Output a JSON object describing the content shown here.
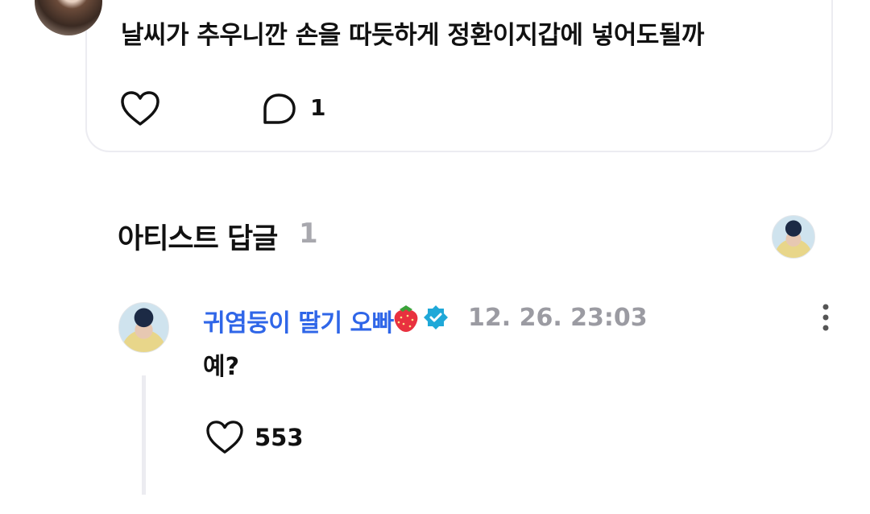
{
  "post": {
    "text": "날씨가 추우니깐 손을 따듯하게 정환이지갑에 넣어도될까",
    "comment_count": "1"
  },
  "artist_replies": {
    "title": "아티스트 답글",
    "count": "1"
  },
  "reply": {
    "author": "귀염둥이 딸기 오빠",
    "timestamp": "12. 26. 23:03",
    "text": "예?",
    "like_count": "553"
  },
  "colors": {
    "accent": "#2f66e8",
    "verified": "#1fa8d8",
    "muted": "#9b9ba2",
    "border": "#ececf1"
  },
  "icons": [
    "heart-icon",
    "comment-bubble-icon",
    "strawberry-icon",
    "verified-badge-icon",
    "more-vertical-icon"
  ]
}
